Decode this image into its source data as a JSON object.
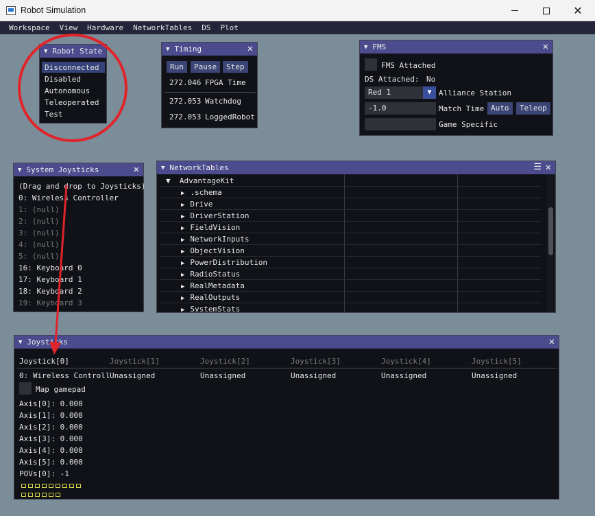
{
  "window": {
    "title": "Robot Simulation"
  },
  "menu": [
    "Workspace",
    "View",
    "Hardware",
    "NetworkTables",
    "DS",
    "Plot"
  ],
  "robot_state": {
    "title": "Robot State",
    "items": [
      "Disconnected",
      "Disabled",
      "Autonomous",
      "Teleoperated",
      "Test"
    ],
    "selected": "Disconnected"
  },
  "timing": {
    "title": "Timing",
    "buttons": [
      "Run",
      "Pause",
      "Step"
    ],
    "rows": [
      {
        "value": "272.046",
        "label": "FPGA Time"
      },
      {
        "value": "272.053",
        "label": "Watchdog"
      },
      {
        "value": "272.053",
        "label": "LoggedRobot"
      }
    ]
  },
  "fms": {
    "title": "FMS",
    "fms_attached_label": "FMS Attached",
    "ds_attached_label": "DS Attached:",
    "ds_attached_value": "No",
    "alliance_value": "Red 1",
    "alliance_label": "Alliance Station",
    "match_time_value": "-1.0",
    "match_time_label": "Match Time",
    "auto_button": "Auto",
    "teleop_button": "Teleop",
    "game_specific_label": "Game Specific"
  },
  "system_joysticks": {
    "title": "System Joysticks",
    "hint": "(Drag and drop to Joysticks)",
    "items": [
      {
        "text": "0: Wireless Controller",
        "dim": false
      },
      {
        "text": "1: (null)",
        "dim": true
      },
      {
        "text": "2: (null)",
        "dim": true
      },
      {
        "text": "3: (null)",
        "dim": true
      },
      {
        "text": "4: (null)",
        "dim": true
      },
      {
        "text": "5: (null)",
        "dim": true
      },
      {
        "text": "16: Keyboard 0",
        "dim": false
      },
      {
        "text": "17: Keyboard 1",
        "dim": false
      },
      {
        "text": "18: Keyboard 2",
        "dim": false
      },
      {
        "text": "19: Keyboard 3",
        "dim": true
      }
    ]
  },
  "networktables": {
    "title": "NetworkTables",
    "root": "AdvantageKit",
    "children": [
      ".schema",
      "Drive",
      "DriverStation",
      "FieldVision",
      "NetworkInputs",
      "ObjectVision",
      "PowerDistribution",
      "RadioStatus",
      "RealMetadata",
      "RealOutputs",
      "SystemStats"
    ]
  },
  "joysticks": {
    "title": "Joysticks",
    "tabs": [
      "Joystick[0]",
      "Joystick[1]",
      "Joystick[2]",
      "Joystick[3]",
      "Joystick[4]",
      "Joystick[5]"
    ],
    "assignments": [
      "0: Wireless Controll",
      "Unassigned",
      "Unassigned",
      "Unassigned",
      "Unassigned",
      "Unassigned"
    ],
    "map_gamepad_label": "Map gamepad",
    "axes": [
      "Axis[0]: 0.000",
      "Axis[1]: 0.000",
      "Axis[2]: 0.000",
      "Axis[3]: 0.000",
      "Axis[4]: 0.000",
      "Axis[5]: 0.000"
    ],
    "povs": "POVs[0]: -1",
    "button_count": 15
  },
  "colors": {
    "workspace": "#7a8d99",
    "title_active": "#4b4b8e",
    "annotation": "#e0242a"
  }
}
